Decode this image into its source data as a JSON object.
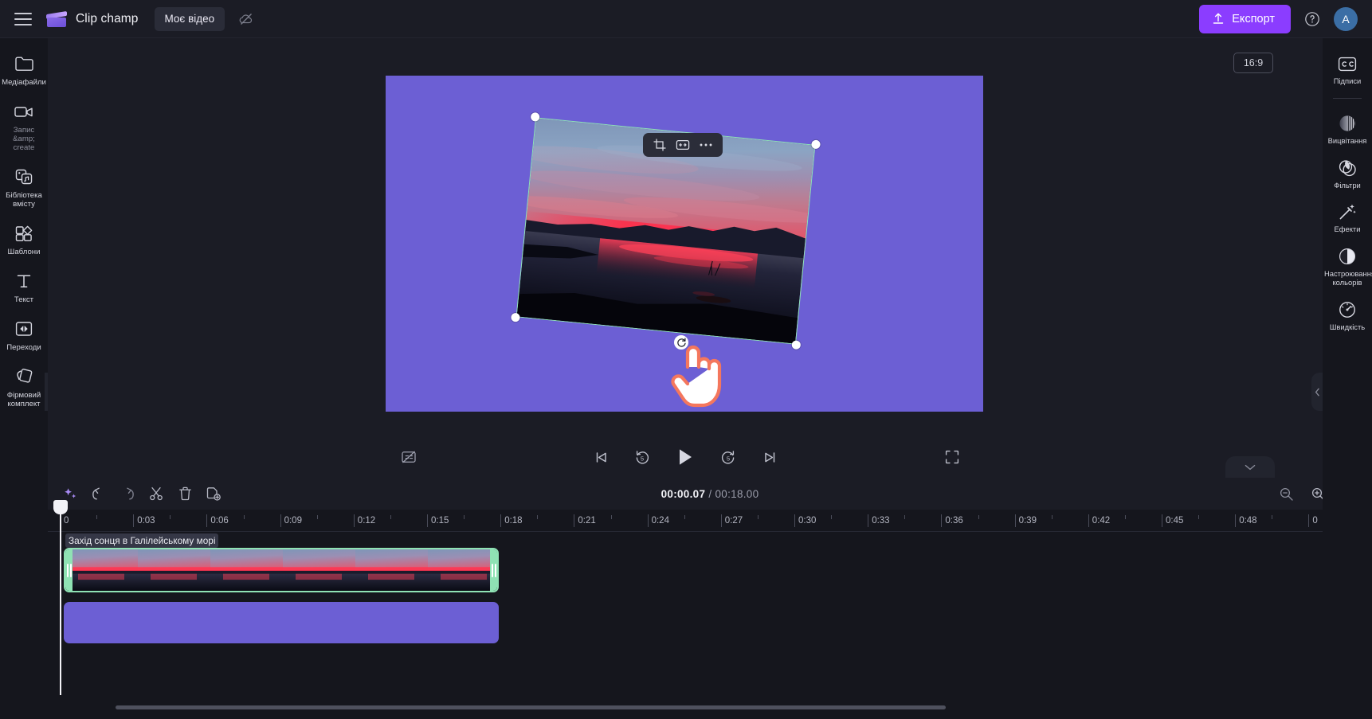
{
  "app": {
    "brand_name": "Clip champ",
    "project_name": "Моє відео",
    "export_label": "Експорт",
    "avatar_initial": "A"
  },
  "left_sidebar": {
    "items": [
      {
        "label": "Медіафайли",
        "icon": "folder-icon",
        "dim": false
      },
      {
        "label": "Запис &amp; create",
        "icon": "video-camera-icon",
        "dim": true
      },
      {
        "label": "Бібліотека вмісту",
        "icon": "content-library-icon",
        "dim": false
      },
      {
        "label": "Шаблони",
        "icon": "templates-icon",
        "dim": false
      },
      {
        "label": "Текст",
        "icon": "text-icon",
        "dim": false
      },
      {
        "label": "Переходи",
        "icon": "transitions-icon",
        "dim": false
      },
      {
        "label": "Фірмовий комплект",
        "icon": "brand-kit-icon",
        "dim": false
      }
    ]
  },
  "right_sidebar": {
    "items": [
      {
        "label": "Підписи",
        "icon": "captions-cc-icon"
      },
      {
        "label": "Вицвітання",
        "icon": "fade-icon"
      },
      {
        "label": "Фільтри",
        "icon": "filters-icon"
      },
      {
        "label": "Ефекти",
        "icon": "effects-wand-icon"
      },
      {
        "label": "Настроювання кольорів",
        "icon": "color-adjust-icon"
      },
      {
        "label": "Швидкість",
        "icon": "speed-gauge-icon"
      }
    ]
  },
  "preview": {
    "aspect_ratio": "16:9",
    "canvas_color": "#6c5fd4",
    "selection_color": "#8fe2b4",
    "float_toolbar": [
      "crop-icon",
      "fit-icon",
      "more-dots-icon"
    ],
    "rotate_handle": "rotate-icon",
    "cursor": "hand-pointer-cursor"
  },
  "playback": {
    "captions_toggle": "captions-off-icon",
    "controls": [
      "skip-previous-icon",
      "rewind-5-icon",
      "play-icon",
      "forward-5-icon",
      "skip-next-icon"
    ],
    "fullscreen": "fullscreen-icon",
    "collapse": "chevron-down-icon"
  },
  "timeline": {
    "toolbar_left": [
      "magic-sparkle-icon",
      "undo-icon",
      "redo-icon",
      "split-scissors-icon",
      "delete-trash-icon",
      "duplicate-icon"
    ],
    "toolbar_right": [
      "zoom-out-icon",
      "zoom-in-icon",
      "fit-timeline-icon"
    ],
    "current_time": "00:00.07",
    "separator": "/",
    "total_time": "00:18.00",
    "ruler_labels": [
      "0",
      "0:03",
      "0:06",
      "0:09",
      "0:12",
      "0:15",
      "0:18",
      "0:21",
      "0:24",
      "0:27",
      "0:30",
      "0:33",
      "0:36",
      "0:39",
      "0:42",
      "0:45",
      "0:48",
      "0"
    ],
    "clip_title": "Захід сонця в Галілейському морі",
    "tracks": [
      {
        "type": "video",
        "label": "Захід сонця в Галілейському морі",
        "selected": true,
        "thumb_count": 6
      },
      {
        "type": "background",
        "label": "",
        "selected": false,
        "color": "#6c5fd4"
      }
    ]
  }
}
